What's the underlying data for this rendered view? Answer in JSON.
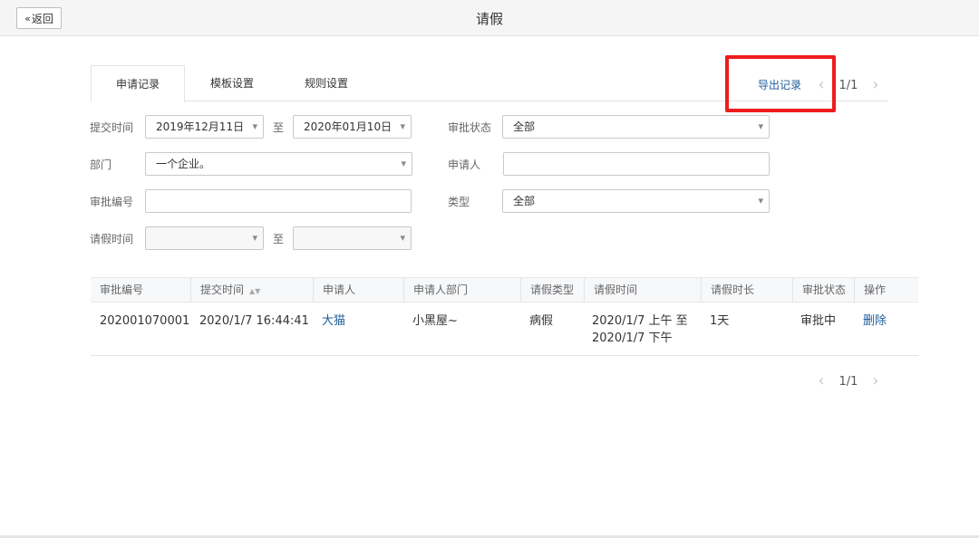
{
  "header": {
    "back_label": "返回",
    "back_icon": "double-chevron-left-icon",
    "title": "请假"
  },
  "tabs": [
    {
      "label": "申请记录",
      "active": true
    },
    {
      "label": "模板设置",
      "active": false
    },
    {
      "label": "规则设置",
      "active": false
    }
  ],
  "toolbar": {
    "export_label": "导出记录",
    "page_text": "1/1",
    "highlight_color": "#ee1c1c"
  },
  "filters": {
    "submit_time_label": "提交时间",
    "submit_time_from": "2019年12月11日",
    "to_label": "至",
    "submit_time_to": "2020年01月10日",
    "approval_status_label": "审批状态",
    "approval_status_value": "全部",
    "department_label": "部门",
    "department_value": "一个企业。",
    "applicant_label": "申请人",
    "applicant_value": "",
    "approval_no_label": "审批编号",
    "approval_no_value": "",
    "type_label": "类型",
    "type_value": "全部",
    "leave_time_label": "请假时间",
    "leave_time_from": "",
    "leave_time_to": ""
  },
  "table": {
    "columns": [
      "审批编号",
      "提交时间",
      "申请人",
      "申请人部门",
      "请假类型",
      "请假时间",
      "请假时长",
      "审批状态",
      "操作"
    ],
    "rows": [
      {
        "approval_no": "202001070001",
        "submit_time": "2020/1/7 16:44:41",
        "applicant": "大猫",
        "department": "小黑屋~",
        "leave_type": "病假",
        "leave_time_line1": "2020/1/7 上午 至",
        "leave_time_line2": "2020/1/7 下午",
        "duration": "1天",
        "status": "审批中",
        "action": "删除"
      }
    ]
  },
  "pagination": {
    "page_text": "1/1"
  },
  "colors": {
    "link": "#1f5c99",
    "header_bg": "#f5f5f5"
  }
}
